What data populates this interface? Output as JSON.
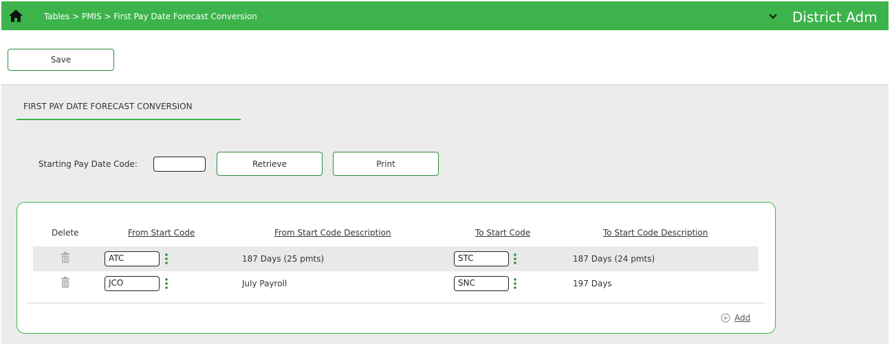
{
  "header": {
    "breadcrumb": "Tables > PMIS > First Pay Date Forecast Conversion",
    "district": "District Adm",
    "bar_color": "#3cb44b"
  },
  "toolbar": {
    "save_label": "Save"
  },
  "section": {
    "title": "FIRST PAY DATE FORECAST CONVERSION"
  },
  "filter": {
    "starting_label": "Starting Pay Date Code:",
    "starting_value": "",
    "retrieve_label": "Retrieve",
    "print_label": "Print"
  },
  "grid": {
    "columns": [
      "Delete",
      "From Start Code",
      "From Start Code Description",
      "To Start Code",
      "To Start Code Description"
    ],
    "rows": [
      {
        "from_code": "ATC",
        "from_desc": "187 Days (25 pmts)",
        "to_code": "STC",
        "to_desc": "187 Days (24 pmts)"
      },
      {
        "from_code": "JCO",
        "from_desc": "July Payroll",
        "to_code": "SNC",
        "to_desc": "197 Days"
      }
    ],
    "add_label": "Add"
  },
  "icons": {
    "home": "home-icon",
    "chevron": "chevron-down-icon",
    "delete": "trash-icon",
    "menu": "kebab-icon",
    "add": "plus-circle-icon"
  }
}
